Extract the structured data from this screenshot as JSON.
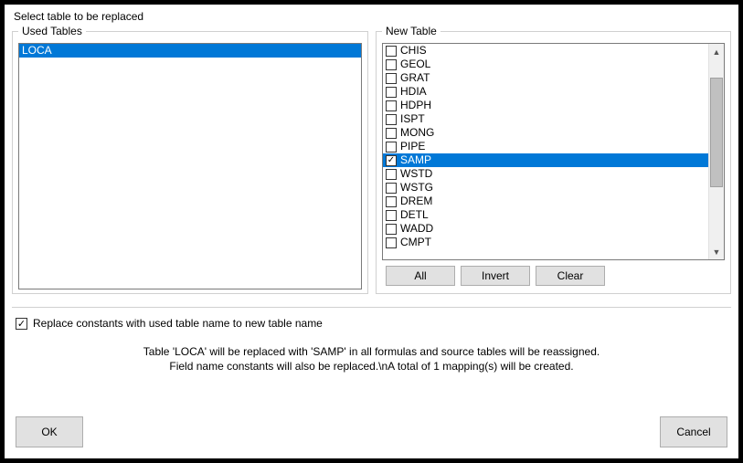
{
  "title": "Select table to be replaced",
  "usedTables": {
    "legend": "Used Tables",
    "items": [
      {
        "label": "LOCA",
        "selected": true
      }
    ]
  },
  "newTable": {
    "legend": "New Table",
    "items": [
      {
        "label": "CHIS",
        "checked": false,
        "selected": false
      },
      {
        "label": "GEOL",
        "checked": false,
        "selected": false
      },
      {
        "label": "GRAT",
        "checked": false,
        "selected": false
      },
      {
        "label": "HDIA",
        "checked": false,
        "selected": false
      },
      {
        "label": "HDPH",
        "checked": false,
        "selected": false
      },
      {
        "label": "ISPT",
        "checked": false,
        "selected": false
      },
      {
        "label": "MONG",
        "checked": false,
        "selected": false
      },
      {
        "label": "PIPE",
        "checked": false,
        "selected": false
      },
      {
        "label": "SAMP",
        "checked": true,
        "selected": true
      },
      {
        "label": "WSTD",
        "checked": false,
        "selected": false
      },
      {
        "label": "WSTG",
        "checked": false,
        "selected": false
      },
      {
        "label": "DREM",
        "checked": false,
        "selected": false
      },
      {
        "label": "DETL",
        "checked": false,
        "selected": false
      },
      {
        "label": "WADD",
        "checked": false,
        "selected": false
      },
      {
        "label": "CMPT",
        "checked": false,
        "selected": false
      }
    ],
    "buttons": {
      "all": "All",
      "invert": "Invert",
      "clear": "Clear"
    }
  },
  "replaceOption": {
    "checked": true,
    "label": "Replace constants with used table name to new table name"
  },
  "message": {
    "line1": "Table 'LOCA' will be replaced with 'SAMP' in all formulas and source tables will be reassigned.",
    "line2": "Field name constants will also be replaced.\\nA total of 1 mapping(s) will be created."
  },
  "footer": {
    "ok": "OK",
    "cancel": "Cancel"
  }
}
